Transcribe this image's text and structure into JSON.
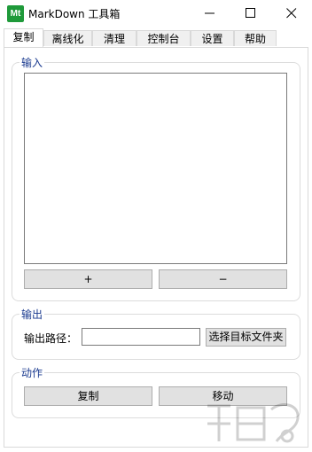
{
  "window": {
    "icon_text": "Mt",
    "title": "MarkDown 工具箱",
    "minimize_icon": "minimize-icon",
    "maximize_icon": "maximize-icon",
    "close_icon": "close-icon"
  },
  "tabs": [
    {
      "label": "复制",
      "active": true
    },
    {
      "label": "离线化",
      "active": false
    },
    {
      "label": "清理",
      "active": false
    },
    {
      "label": "控制台",
      "active": false
    },
    {
      "label": "设置",
      "active": false
    },
    {
      "label": "帮助",
      "active": false
    }
  ],
  "input_group": {
    "legend": "输入",
    "textarea_value": "",
    "add_label": "+",
    "remove_label": "−"
  },
  "output_group": {
    "legend": "输出",
    "path_label": "输出路径：",
    "path_value": "",
    "browse_label": "选择目标文件夹"
  },
  "action_group": {
    "legend": "动作",
    "copy_label": "复制",
    "move_label": "移动"
  },
  "colors": {
    "accent": "#1a3a8f",
    "icon_bg": "#1f9a3a",
    "button_bg": "#e1e1e1"
  }
}
